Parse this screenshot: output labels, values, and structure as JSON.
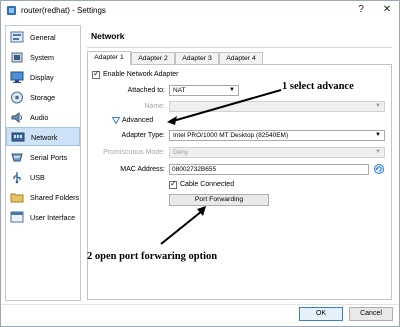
{
  "window": {
    "title": "router(redhat) - Settings",
    "help_label": "?",
    "close_label": "✕"
  },
  "sidebar": {
    "items": [
      {
        "label": "General",
        "icon": "general-icon"
      },
      {
        "label": "System",
        "icon": "system-icon"
      },
      {
        "label": "Display",
        "icon": "display-icon"
      },
      {
        "label": "Storage",
        "icon": "storage-icon"
      },
      {
        "label": "Audio",
        "icon": "audio-icon"
      },
      {
        "label": "Network",
        "icon": "network-icon",
        "active": true
      },
      {
        "label": "Serial Ports",
        "icon": "serial-ports-icon"
      },
      {
        "label": "USB",
        "icon": "usb-icon"
      },
      {
        "label": "Shared Folders",
        "icon": "shared-folders-icon"
      },
      {
        "label": "User Interface",
        "icon": "user-interface-icon"
      }
    ]
  },
  "section": {
    "title": "Network"
  },
  "tabs": [
    "Adapter 1",
    "Adapter 2",
    "Adapter 3",
    "Adapter 4"
  ],
  "adapter": {
    "enable_label": "Enable Network Adapter",
    "attached_label": "Attached to:",
    "attached_value": "NAT",
    "name_label": "Name:",
    "name_value": "",
    "advanced_label": "Advanced",
    "adapter_type_label": "Adapter Type:",
    "adapter_type_value": "Intel PRO/1000 MT Desktop (82540EM)",
    "promiscuous_label": "Promiscuous Mode:",
    "promiscuous_value": "Deny",
    "mac_label": "MAC Address:",
    "mac_value": "08002732B655",
    "cable_label": "Cable Connected",
    "port_forwarding_label": "Port Forwarding"
  },
  "annotations": {
    "step1": "1 select advance",
    "step2": "2 open port forwaring option"
  },
  "footer": {
    "ok_label": "OK",
    "cancel_label": "Cancel"
  },
  "colors": {
    "accent": "#2f7fd6",
    "selected_bg": "#cde2f6"
  }
}
